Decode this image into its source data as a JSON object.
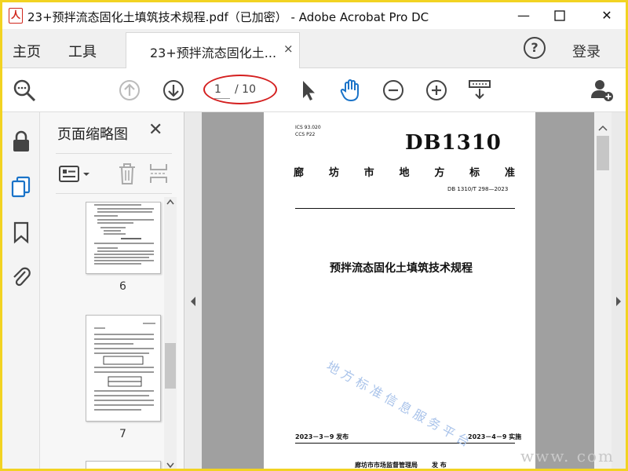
{
  "window": {
    "title": "23+预拌流态固化土填筑技术规程.pdf（已加密） - Adobe Acrobat Pro DC",
    "app_icon": "acrobat-icon",
    "minimize": "—",
    "maximize": "☐",
    "close": "✕"
  },
  "menu": {
    "home": "主页",
    "tools": "工具",
    "tab_label": "23+预拌流态固化土...",
    "tab_close": "×",
    "help": "?",
    "login": "登录"
  },
  "toolbar": {
    "page_current": "1",
    "page_total": "/ 10"
  },
  "thumbnail_panel": {
    "title": "页面缩略图",
    "close": "✕",
    "thumbs": [
      {
        "label": "6"
      },
      {
        "label": "7"
      }
    ]
  },
  "document": {
    "ics": "ICS  93.020",
    "ccs": "CCS  P22",
    "db_code": "DB1310",
    "region": [
      "廊",
      "坊",
      "市",
      "地",
      "方",
      "标",
      "准"
    ],
    "std_number": "DB 1310/T 298—2023",
    "title": "预拌流态固化土填筑技术规程",
    "publish_date": "2023－3－9 发布",
    "effective_date": "2023－4－9 实施",
    "issuer": "廊坊市市场监督管理局",
    "issuer_action": "发  布",
    "watermark": "地方标准信息服务平台"
  },
  "corner_watermark": "www.      com"
}
